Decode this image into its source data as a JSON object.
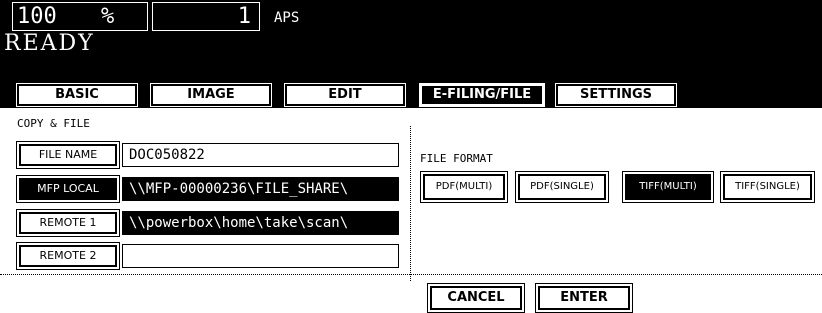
{
  "status": {
    "zoom_value": "100",
    "zoom_unit": "%",
    "copies": "1",
    "paper_mode": "APS",
    "state": "READY"
  },
  "tabs": [
    {
      "label": "BASIC",
      "active": false
    },
    {
      "label": "IMAGE",
      "active": false
    },
    {
      "label": "EDIT",
      "active": false
    },
    {
      "label": "E-FILING/FILE",
      "active": true
    },
    {
      "label": "SETTINGS",
      "active": false
    }
  ],
  "copy_file": {
    "title": "COPY & FILE",
    "rows": [
      {
        "button": "FILE NAME",
        "value": "DOC050822",
        "selected": false
      },
      {
        "button": "MFP LOCAL",
        "value": "\\\\MFP-00000236\\FILE_SHARE\\",
        "selected": true
      },
      {
        "button": "REMOTE 1",
        "value": "\\\\powerbox\\home\\take\\scan\\",
        "selected": true
      },
      {
        "button": "REMOTE 2",
        "value": "",
        "selected": false
      }
    ]
  },
  "file_format": {
    "label": "FILE FORMAT",
    "options": [
      {
        "label": "PDF(MULTI)",
        "selected": false
      },
      {
        "label": "PDF(SINGLE)",
        "selected": false
      },
      {
        "label": "TIFF(MULTI)",
        "selected": true
      },
      {
        "label": "TIFF(SINGLE)",
        "selected": false
      }
    ]
  },
  "actions": {
    "cancel": "CANCEL",
    "enter": "ENTER"
  }
}
